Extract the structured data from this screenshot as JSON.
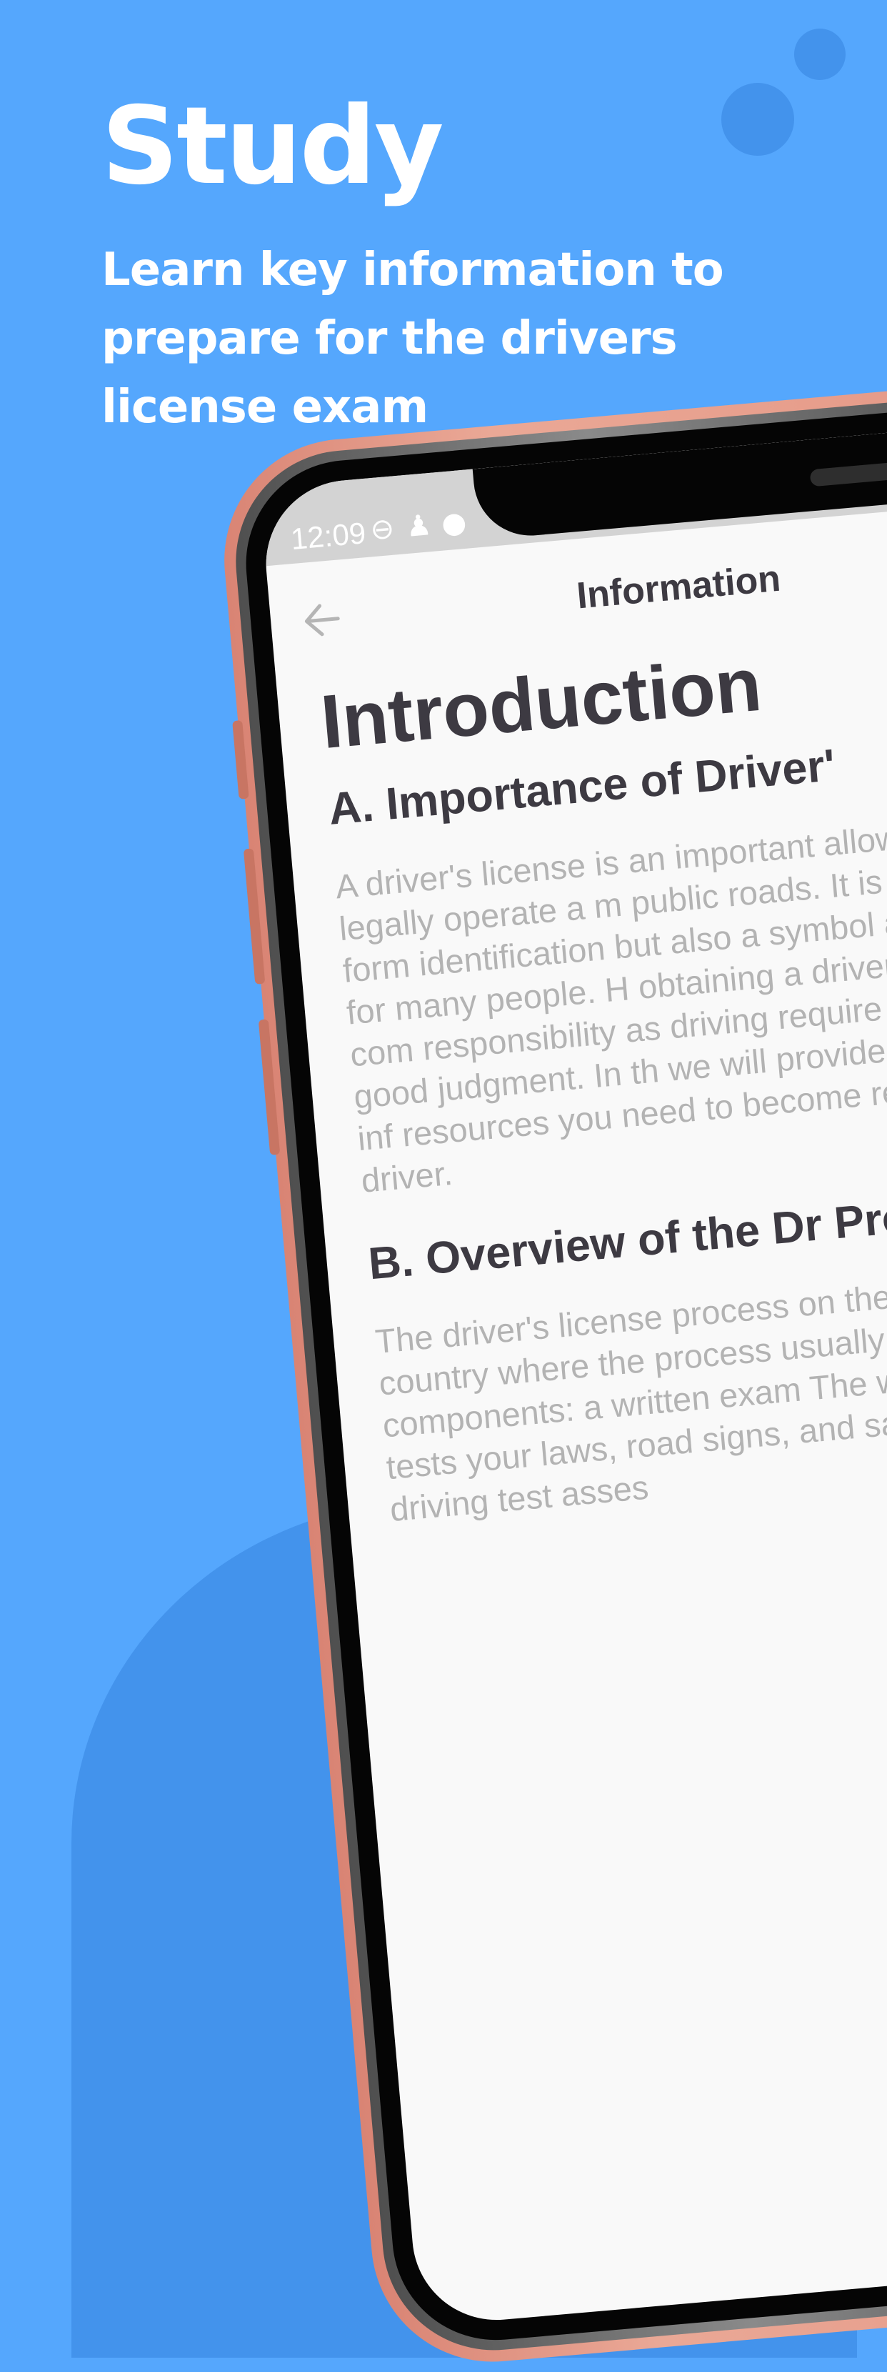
{
  "promo": {
    "title": "Study",
    "subtitle": "Learn key information to prepare for the drivers license exam"
  },
  "status_bar": {
    "time": "12:09",
    "icons": [
      "do-not-disturb-icon",
      "snapchat-icon",
      "notification-icon"
    ]
  },
  "app_bar": {
    "back_icon": "arrow-left-icon",
    "title": "Information"
  },
  "article": {
    "heading": "Introduction",
    "sections": [
      {
        "title": "A. Importance of Driver'",
        "body": "A driver's license is an important allows you to legally operate a m public roads. It is not only a form identification but also a symbol and freedom for many people. H obtaining a driver's license com responsibility as driving require skills, and good judgment. In th we will provide you with the inf resources you need to become responsible driver."
      },
      {
        "title": "B. Overview of the Dr Process",
        "body": "The driver's license process on the state or country where the process usually involves components: a written exam The written exam tests your laws, road signs, and safe d while the driving test asses"
      }
    ]
  },
  "colors": {
    "background": "#55a7fd",
    "decoration": "#4393ec",
    "phone_frame": "#e49482",
    "heading_text": "#3d3a42",
    "body_text": "#b3b3b3"
  }
}
